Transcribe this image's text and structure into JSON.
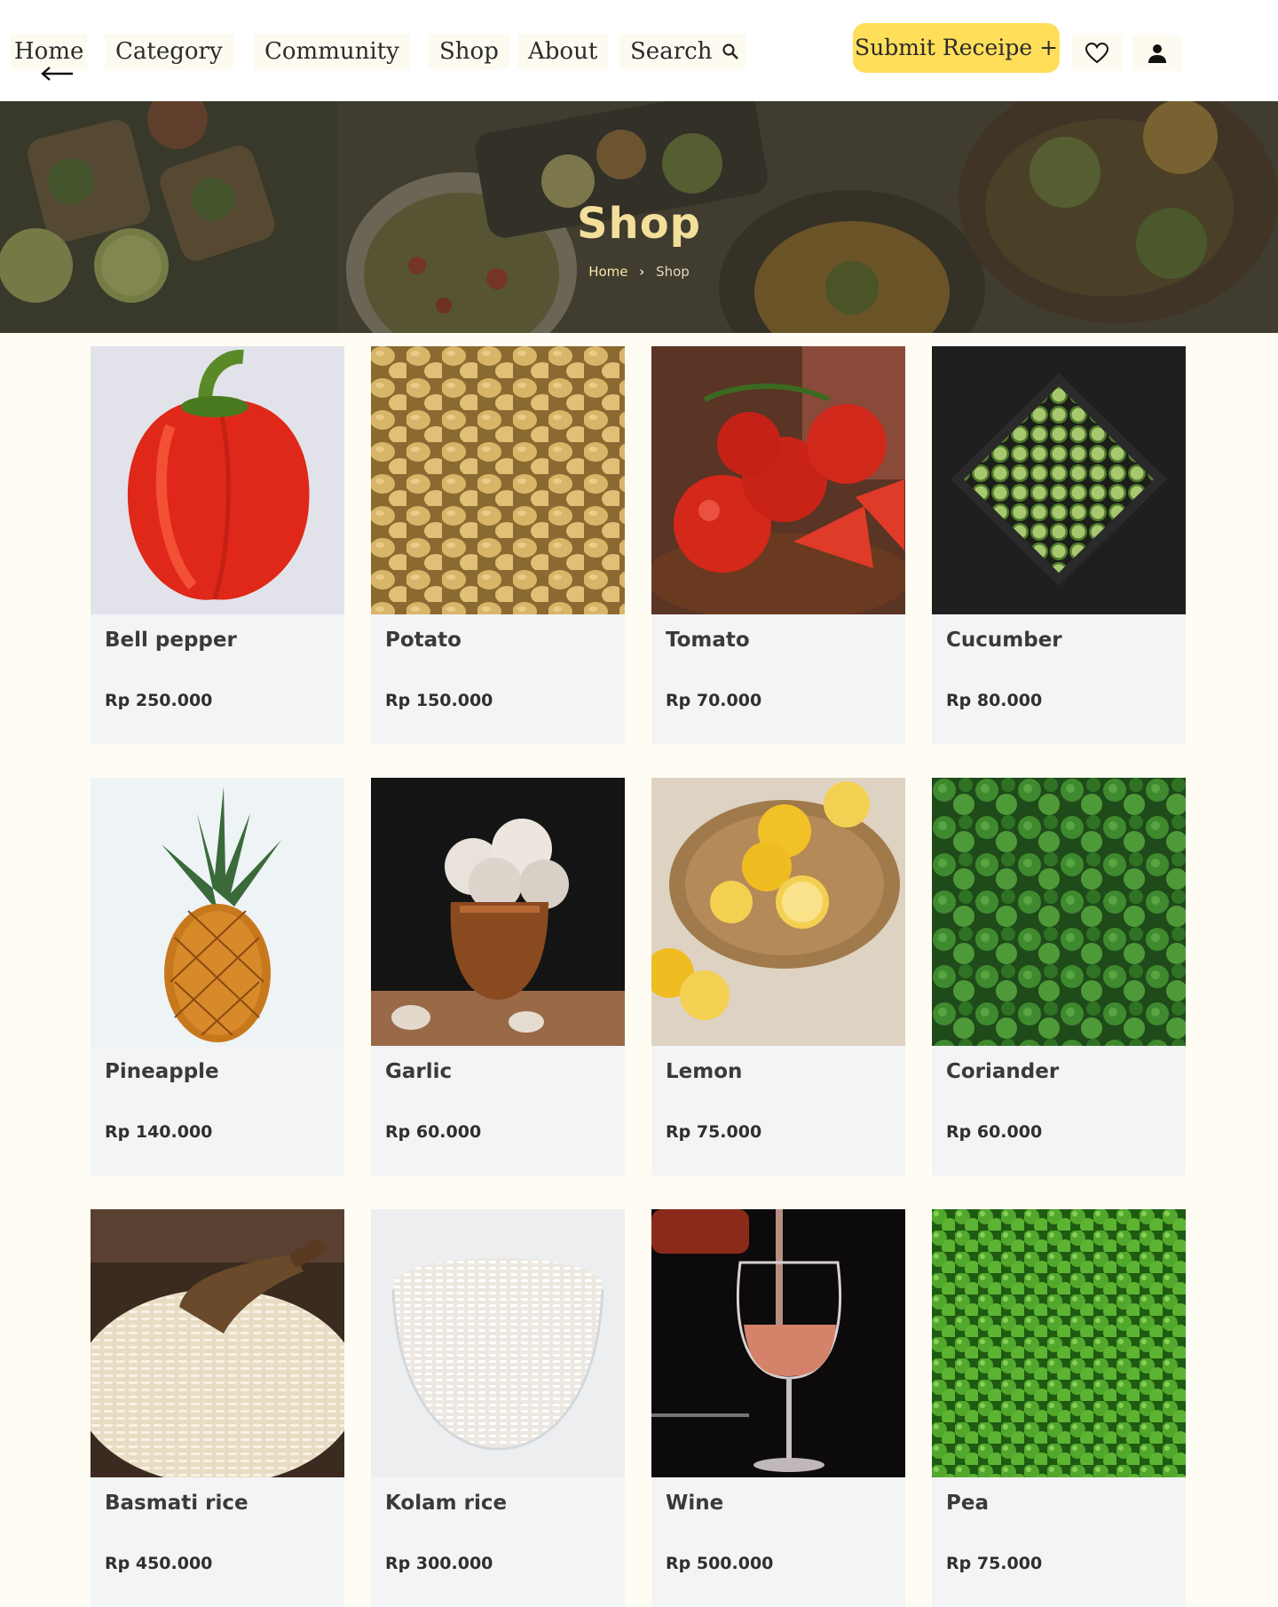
{
  "nav": {
    "home": "Home",
    "category": "Category",
    "community": "Community",
    "shop": "Shop",
    "about": "About",
    "search": "Search",
    "submit": "Submit Receipe +"
  },
  "hero": {
    "title": "Shop",
    "breadcrumb": {
      "home": "Home",
      "current": "Shop"
    }
  },
  "colors": {
    "accent": "#ffde59",
    "page_background": "#fffdf3",
    "card_background": "#f3f4f6",
    "hero_title": "#f3df9a"
  },
  "products": [
    {
      "name": "Bell pepper",
      "price": "Rp 250.000",
      "icon": "bell-pepper-image"
    },
    {
      "name": "Potato",
      "price": "Rp 150.000",
      "icon": "potato-image"
    },
    {
      "name": "Tomato",
      "price": "Rp 70.000",
      "icon": "tomato-image"
    },
    {
      "name": "Cucumber",
      "price": "Rp 80.000",
      "icon": "cucumber-image"
    },
    {
      "name": "Pineapple",
      "price": "Rp 140.000",
      "icon": "pineapple-image"
    },
    {
      "name": "Garlic",
      "price": "Rp 60.000",
      "icon": "garlic-image"
    },
    {
      "name": "Lemon",
      "price": "Rp 75.000",
      "icon": "lemon-image"
    },
    {
      "name": "Coriander",
      "price": "Rp 60.000",
      "icon": "coriander-image"
    },
    {
      "name": "Basmati rice",
      "price": "Rp 450.000",
      "icon": "basmati-rice-image"
    },
    {
      "name": "Kolam rice",
      "price": "Rp 300.000",
      "icon": "kolam-rice-image"
    },
    {
      "name": "Wine",
      "price": "Rp 500.000",
      "icon": "wine-image"
    },
    {
      "name": "Pea",
      "price": "Rp 75.000",
      "icon": "pea-image"
    }
  ]
}
